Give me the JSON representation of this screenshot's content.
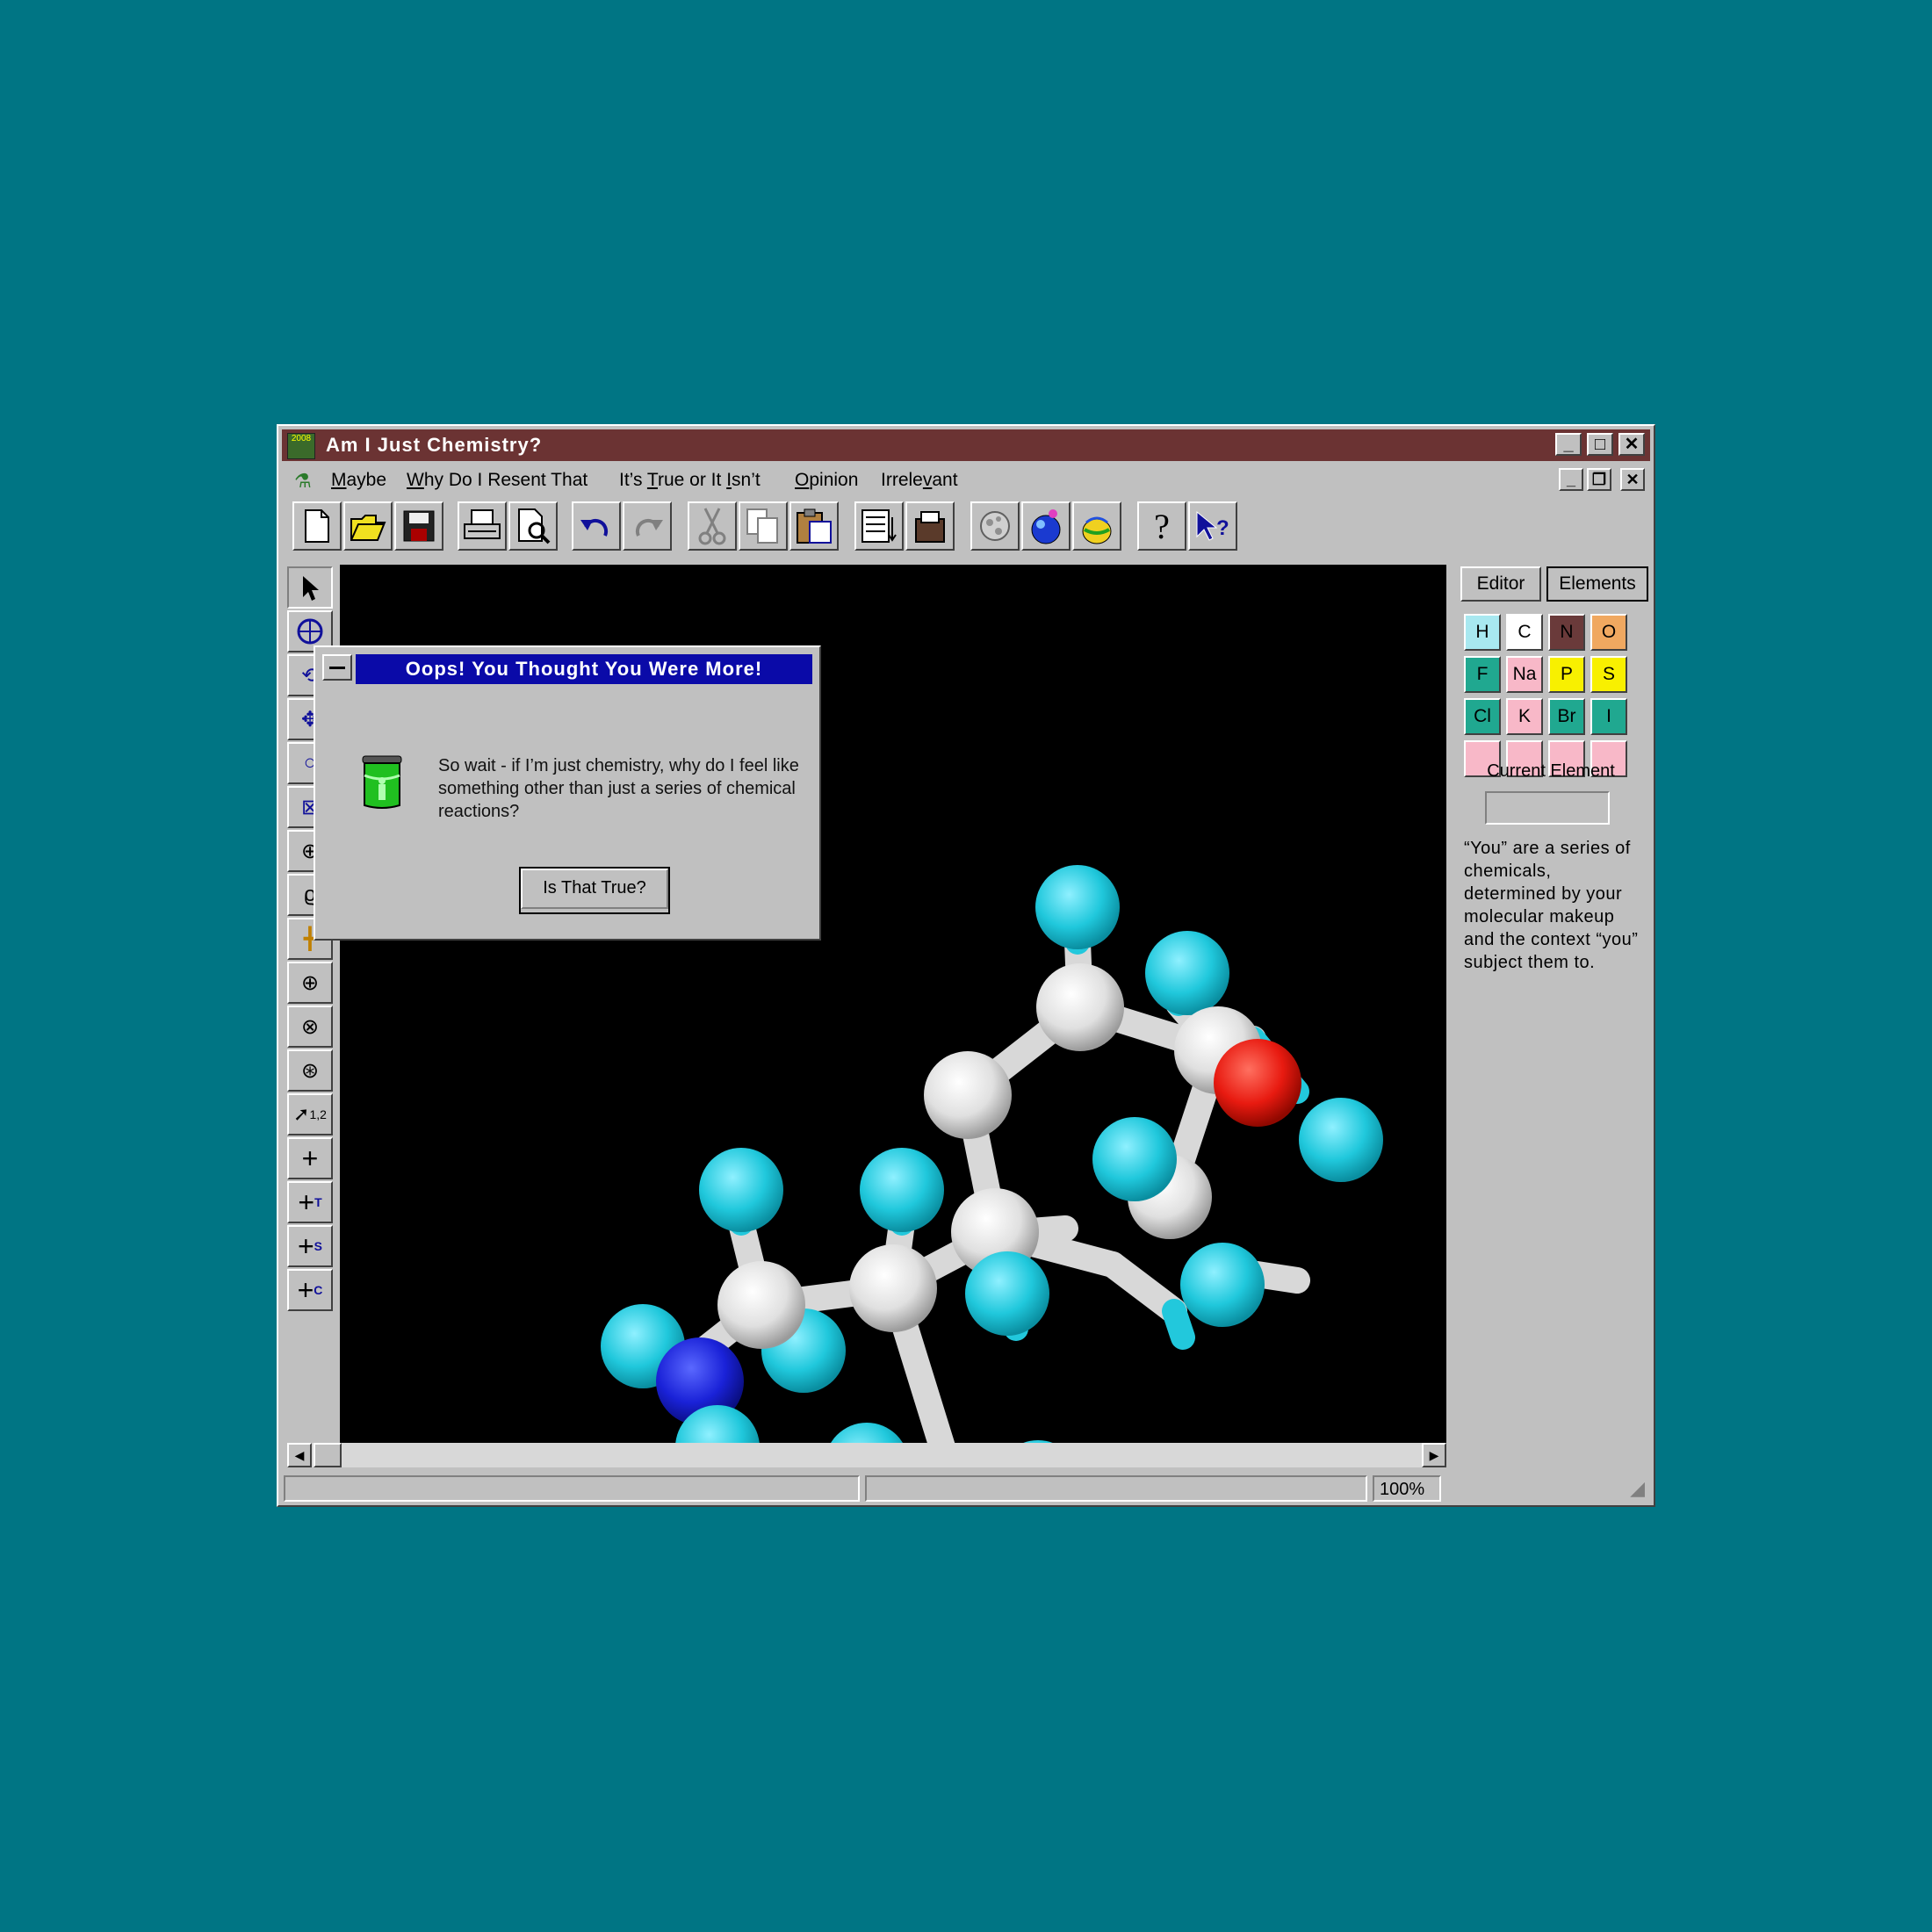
{
  "window": {
    "title": "Am I Just Chemistry?",
    "icon_label": "2008",
    "controls": [
      "minimize-icon",
      "maximize-icon",
      "close-icon"
    ]
  },
  "menu": {
    "items": [
      {
        "label": "Maybe",
        "accel": "M"
      },
      {
        "label": "Why Do I Resent That",
        "accel": "W"
      },
      {
        "label": "It's True or It Isn't",
        "accel": "T"
      },
      {
        "label": "Opinion",
        "accel": "O"
      },
      {
        "label": "Irrelevant",
        "accel": "v"
      }
    ],
    "mdi_controls": [
      "minimize-icon",
      "restore-icon",
      "close-icon"
    ]
  },
  "toolbar": {
    "buttons": [
      "new-file-icon",
      "open-folder-icon",
      "save-icon",
      "print-icon",
      "print-preview-icon",
      "undo-icon",
      "redo-icon",
      "cut-icon",
      "copy-icon",
      "paste-icon",
      "list-icon",
      "clipboard-icon",
      "atom-icon",
      "flask-icon",
      "beaker-icon",
      "help-icon",
      "context-help-icon"
    ]
  },
  "left_tools": {
    "icons": [
      "pointer-icon",
      "rotate-icon",
      "rotate-z-icon",
      "move-icon",
      "circle-icon",
      "zoom-icon",
      "center-icon",
      "lasso-icon",
      "crosshair-icon",
      "select-atom-icon",
      "select-group-icon",
      "select-all-icon",
      "number-atoms-icon",
      "plus-icon",
      "plus-t-icon",
      "plus-s-icon",
      "plus-c-icon"
    ],
    "number_label": "1,2",
    "plus_subs": [
      "T",
      "S",
      "C"
    ]
  },
  "right_panel": {
    "tabs": [
      "Editor",
      "Elements"
    ],
    "elements": [
      {
        "symbol": "H",
        "color": "#a8e8f0"
      },
      {
        "symbol": "C",
        "color": "#ffffff"
      },
      {
        "symbol": "N",
        "color": "#6a3a3a"
      },
      {
        "symbol": "O",
        "color": "#f0a860"
      },
      {
        "symbol": "F",
        "color": "#20a890"
      },
      {
        "symbol": "Na",
        "color": "#f8b8c8"
      },
      {
        "symbol": "P",
        "color": "#f8f000"
      },
      {
        "symbol": "S",
        "color": "#f8f000"
      },
      {
        "symbol": "Cl",
        "color": "#20a890"
      },
      {
        "symbol": "K",
        "color": "#f8b8c8"
      },
      {
        "symbol": "Br",
        "color": "#20a890"
      },
      {
        "symbol": "I",
        "color": "#20a890"
      },
      {
        "symbol": "",
        "color": "#f8b8c8"
      },
      {
        "symbol": "",
        "color": "#f8b8c8"
      },
      {
        "symbol": "",
        "color": "#f8b8c8"
      },
      {
        "symbol": "",
        "color": "#f8b8c8"
      }
    ],
    "current_element_label": "Current Element",
    "current_element_value": "",
    "description": "“You” are a series of chemicals, determined by your molecular makeup and the context “you” subject them to."
  },
  "status": {
    "pane1": "",
    "pane2": "",
    "zoom": "100%"
  },
  "dialog": {
    "title": "Oops! You Thought You Were More!",
    "message": "So wait - if I’m just chemistry, why do I feel like something other than just a series of chemical reactions?",
    "button": "Is That True?",
    "icon": "beaker-icon"
  },
  "colors": {
    "desktop": "#007584",
    "titlebar": "#6b3333",
    "dialog_titlebar": "#0a0aa8",
    "hydrogen": "#22c8dc",
    "carbon": "#e8e8e8",
    "nitrogen": "#1a22d8",
    "oxygen": "#e81a10"
  }
}
